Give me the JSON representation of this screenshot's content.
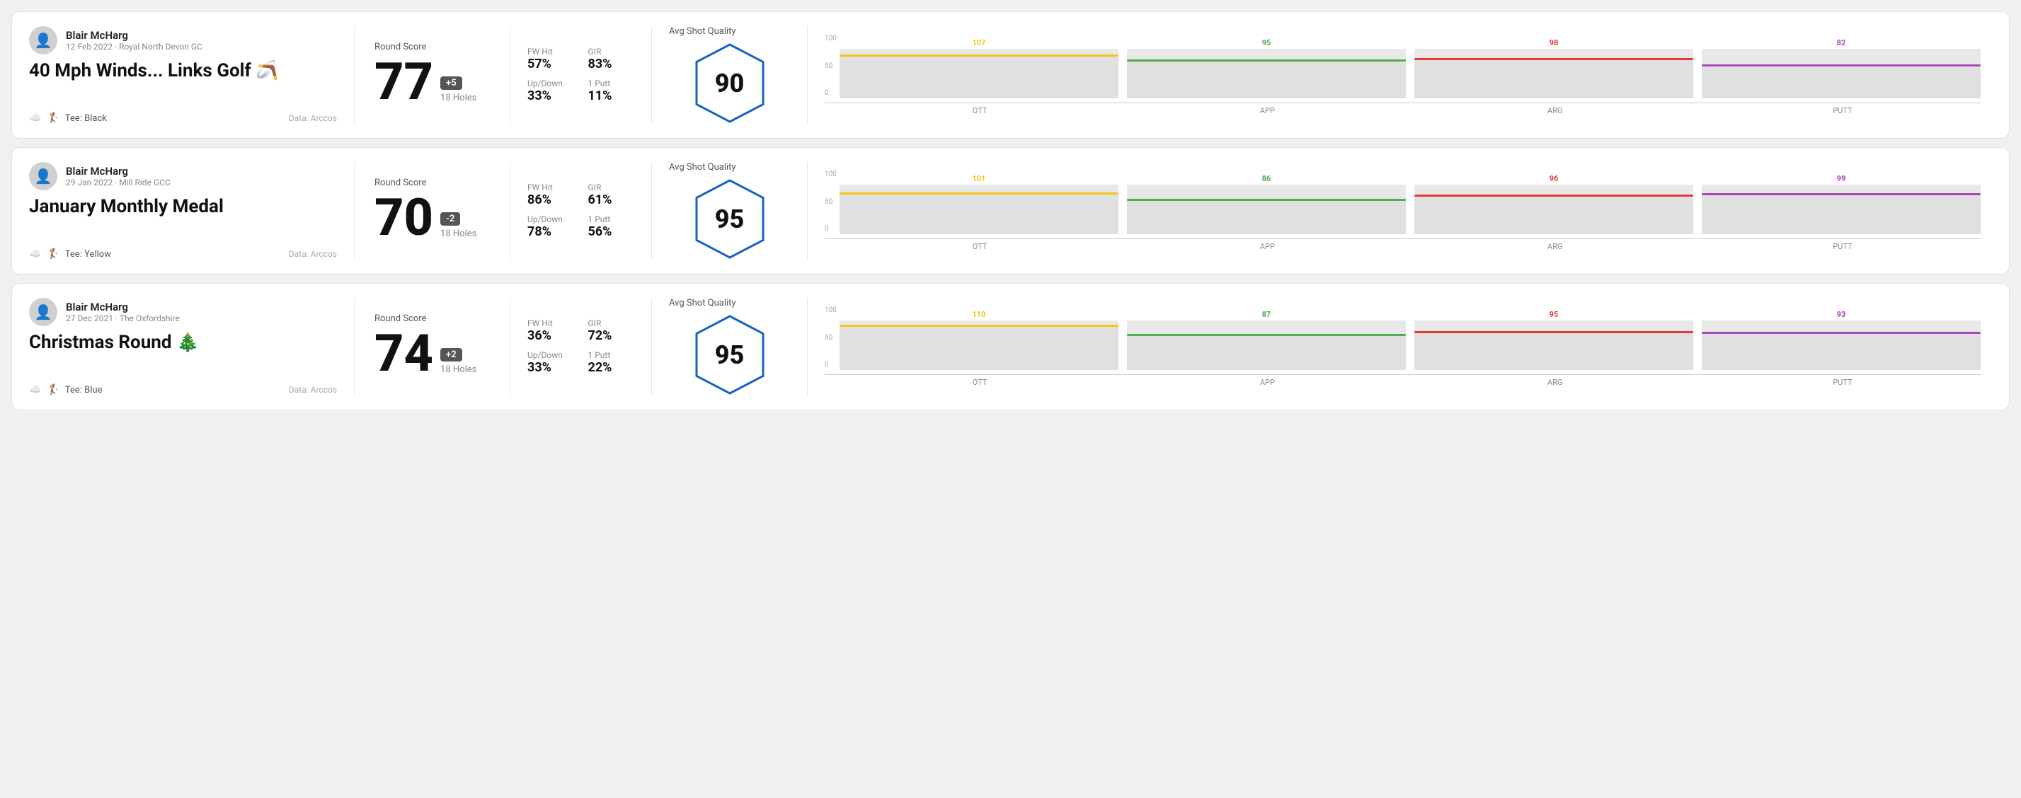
{
  "rounds": [
    {
      "id": "round1",
      "user": {
        "name": "Blair McHarg",
        "date_course": "12 Feb 2022 · Royal North Devon GC"
      },
      "title": "40 Mph Winds... Links Golf 🪃",
      "tee": "Black",
      "data_source": "Data: Arccos",
      "score": {
        "label": "Round Score",
        "number": "77",
        "badge": "+5",
        "badge_type": "positive",
        "holes": "18 Holes"
      },
      "stats": {
        "fw_hit_label": "FW Hit",
        "fw_hit_value": "57%",
        "gir_label": "GIR",
        "gir_value": "83%",
        "updown_label": "Up/Down",
        "updown_value": "33%",
        "oneputt_label": "1 Putt",
        "oneputt_value": "11%"
      },
      "quality": {
        "label": "Avg Shot Quality",
        "score": "90"
      },
      "chart": {
        "bars": [
          {
            "label": "OTT",
            "value": 107,
            "color": "#f5c518",
            "max": 120,
            "line_color": "#f5c518"
          },
          {
            "label": "APP",
            "value": 95,
            "color": "#4caf50",
            "max": 120,
            "line_color": "#4caf50"
          },
          {
            "label": "ARG",
            "value": 98,
            "color": "#e53935",
            "max": 120,
            "line_color": "#e53935"
          },
          {
            "label": "PUTT",
            "value": 82,
            "color": "#ab47bc",
            "max": 120,
            "line_color": "#ab47bc"
          }
        ],
        "y_labels": [
          "100",
          "50",
          "0"
        ]
      }
    },
    {
      "id": "round2",
      "user": {
        "name": "Blair McHarg",
        "date_course": "29 Jan 2022 · Mill Ride GCC"
      },
      "title": "January Monthly Medal",
      "tee": "Yellow",
      "data_source": "Data: Arccos",
      "score": {
        "label": "Round Score",
        "number": "70",
        "badge": "-2",
        "badge_type": "negative",
        "holes": "18 Holes"
      },
      "stats": {
        "fw_hit_label": "FW Hit",
        "fw_hit_value": "86%",
        "gir_label": "GIR",
        "gir_value": "61%",
        "updown_label": "Up/Down",
        "updown_value": "78%",
        "oneputt_label": "1 Putt",
        "oneputt_value": "56%"
      },
      "quality": {
        "label": "Avg Shot Quality",
        "score": "95"
      },
      "chart": {
        "bars": [
          {
            "label": "OTT",
            "value": 101,
            "color": "#f5c518",
            "max": 120,
            "line_color": "#f5c518"
          },
          {
            "label": "APP",
            "value": 86,
            "color": "#4caf50",
            "max": 120,
            "line_color": "#4caf50"
          },
          {
            "label": "ARG",
            "value": 96,
            "color": "#e53935",
            "max": 120,
            "line_color": "#e53935"
          },
          {
            "label": "PUTT",
            "value": 99,
            "color": "#ab47bc",
            "max": 120,
            "line_color": "#ab47bc"
          }
        ],
        "y_labels": [
          "100",
          "50",
          "0"
        ]
      }
    },
    {
      "id": "round3",
      "user": {
        "name": "Blair McHarg",
        "date_course": "27 Dec 2021 · The Oxfordshire"
      },
      "title": "Christmas Round 🎄",
      "tee": "Blue",
      "data_source": "Data: Arccos",
      "score": {
        "label": "Round Score",
        "number": "74",
        "badge": "+2",
        "badge_type": "positive",
        "holes": "18 Holes"
      },
      "stats": {
        "fw_hit_label": "FW Hit",
        "fw_hit_value": "36%",
        "gir_label": "GIR",
        "gir_value": "72%",
        "updown_label": "Up/Down",
        "updown_value": "33%",
        "oneputt_label": "1 Putt",
        "oneputt_value": "22%"
      },
      "quality": {
        "label": "Avg Shot Quality",
        "score": "95"
      },
      "chart": {
        "bars": [
          {
            "label": "OTT",
            "value": 110,
            "color": "#f5c518",
            "max": 120,
            "line_color": "#f5c518"
          },
          {
            "label": "APP",
            "value": 87,
            "color": "#4caf50",
            "max": 120,
            "line_color": "#4caf50"
          },
          {
            "label": "ARG",
            "value": 95,
            "color": "#e53935",
            "max": 120,
            "line_color": "#e53935"
          },
          {
            "label": "PUTT",
            "value": 93,
            "color": "#ab47bc",
            "max": 120,
            "line_color": "#ab47bc"
          }
        ],
        "y_labels": [
          "100",
          "50",
          "0"
        ]
      }
    }
  ]
}
